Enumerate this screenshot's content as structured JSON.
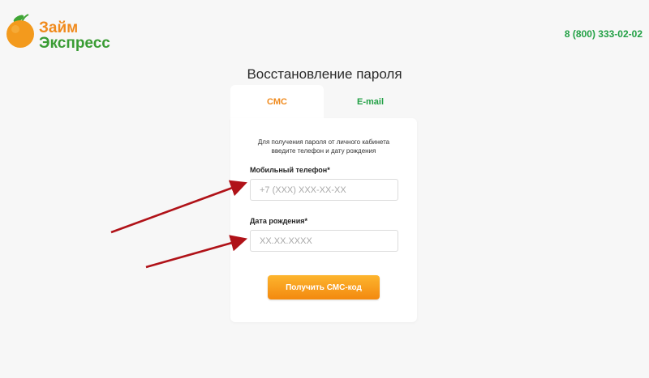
{
  "logo": {
    "line1": "Займ",
    "line2": "Экспресс"
  },
  "header": {
    "phone": "8 (800) 333-02-02"
  },
  "page": {
    "title": "Восстановление пароля"
  },
  "tabs": [
    {
      "label": "СМС",
      "active": true
    },
    {
      "label": "E-mail",
      "active": false
    }
  ],
  "form": {
    "hint_line1": "Для получения пароля от личного кабинета",
    "hint_line2": "введите телефон и дату рождения",
    "phone_label": "Мобильный телефон*",
    "phone_placeholder": "+7 (XXX) XXX-XX-XX",
    "birth_label": "Дата рождения*",
    "birth_placeholder": "XX.XX.XXXX",
    "submit_label": "Получить СМС-код"
  },
  "colors": {
    "brand_orange": "#f08a1c",
    "brand_green": "#22a045",
    "annotation_arrow": "#b01218"
  }
}
